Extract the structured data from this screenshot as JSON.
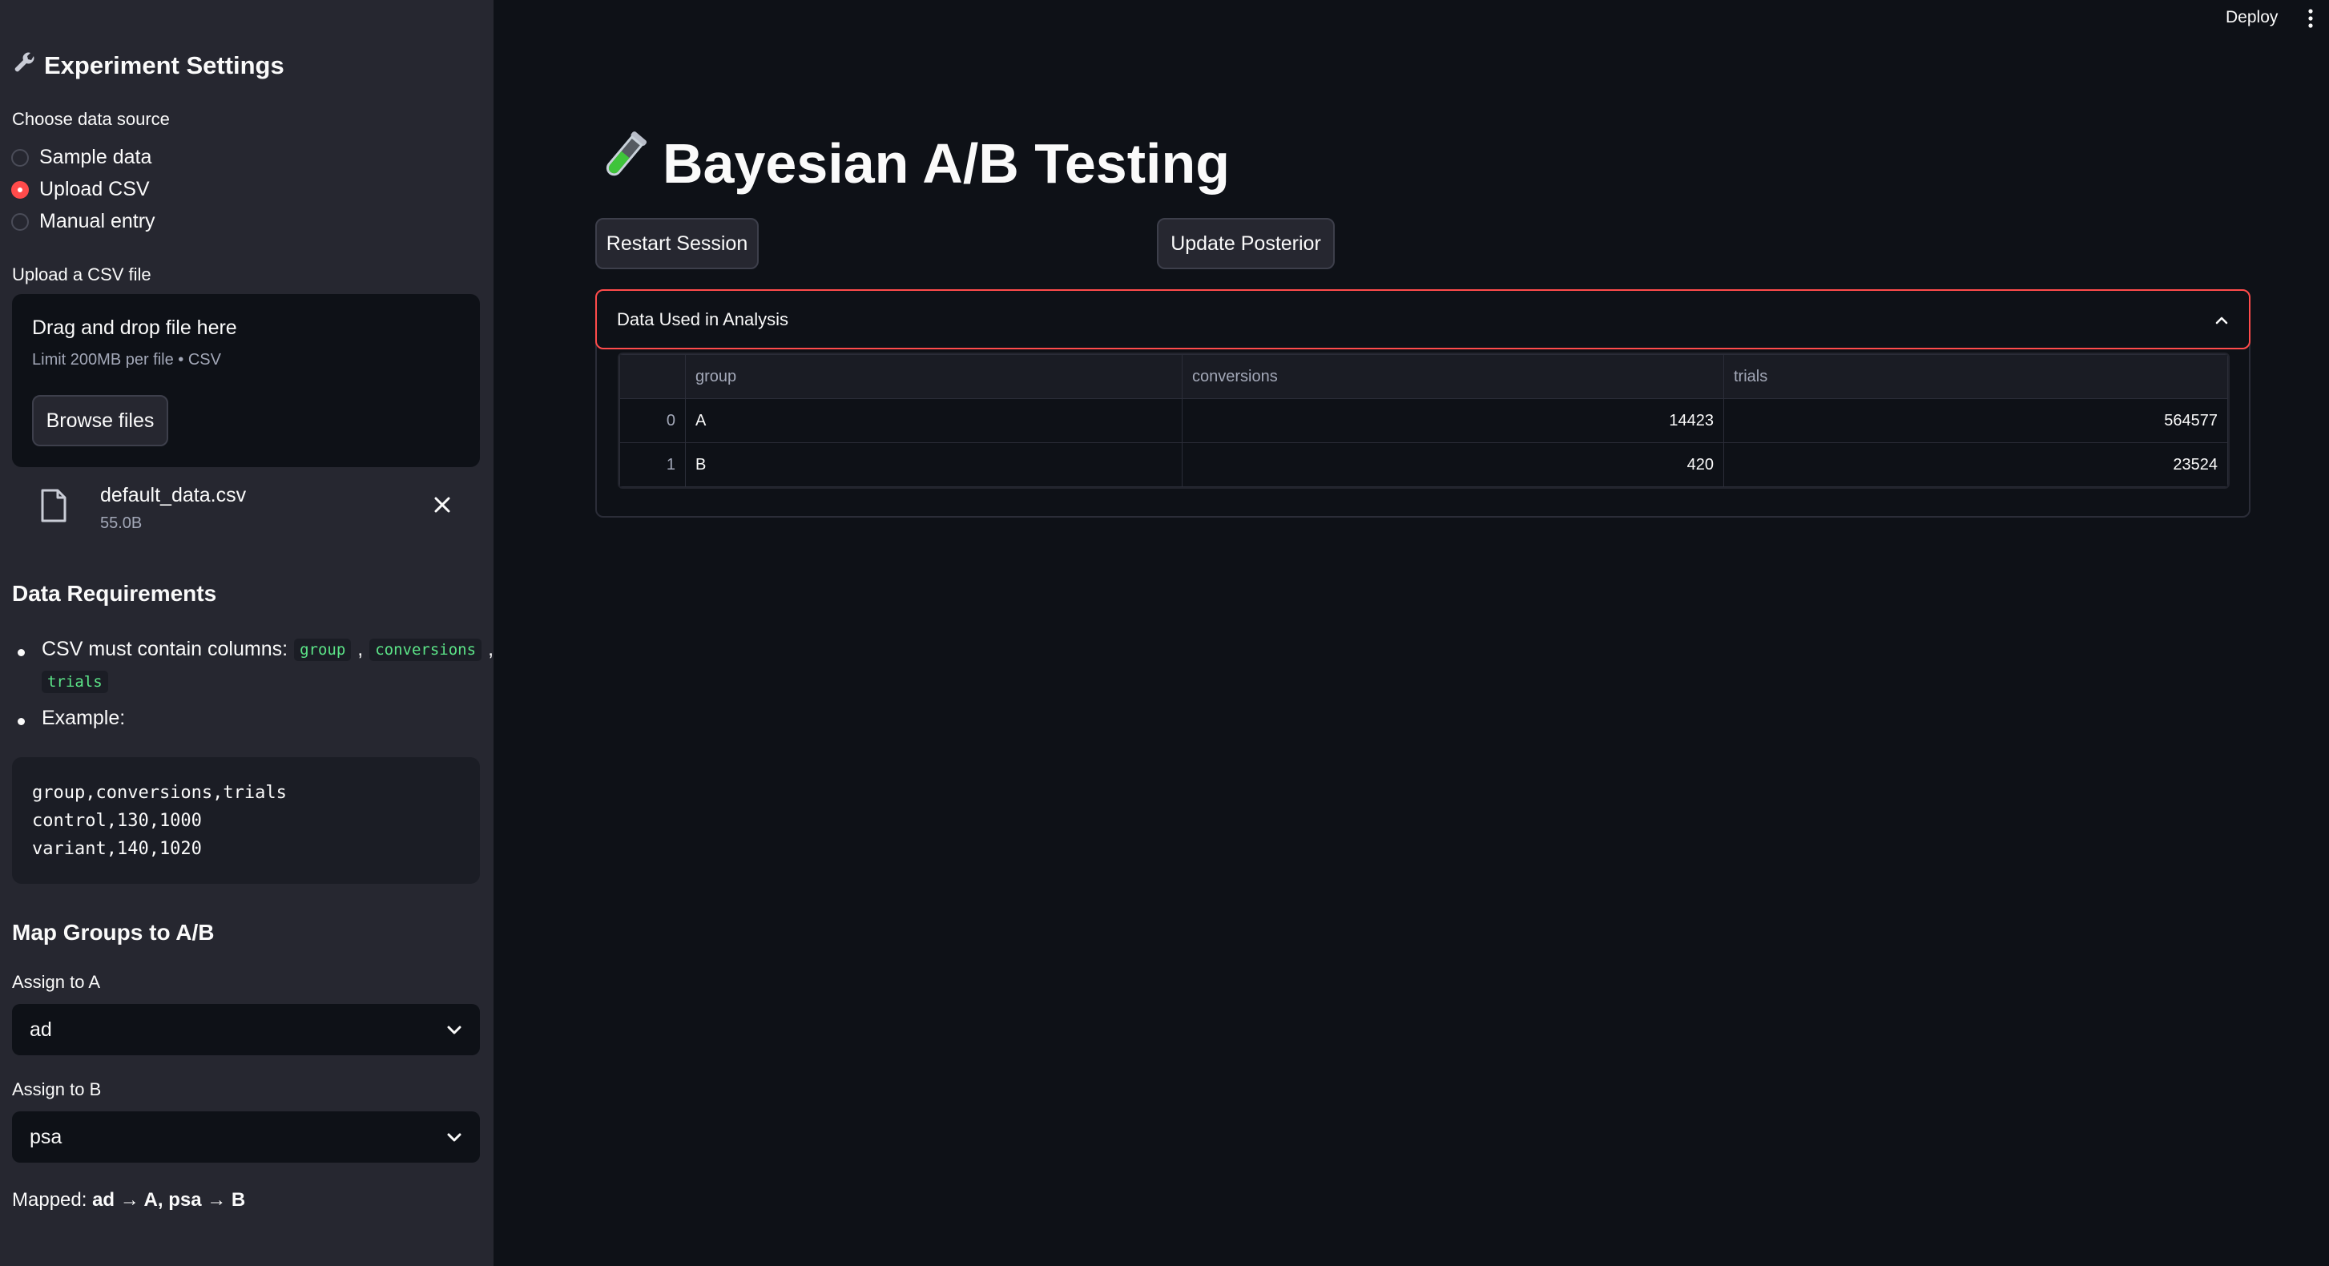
{
  "header": {
    "deploy_label": "Deploy"
  },
  "sidebar": {
    "title": "Experiment Settings",
    "data_source_label": "Choose data source",
    "data_source_options": [
      "Sample data",
      "Upload CSV",
      "Manual entry"
    ],
    "data_source_selected": "Upload CSV",
    "upload_label": "Upload a CSV file",
    "dropzone_title": "Drag and drop file here",
    "dropzone_limit": "Limit 200MB per file • CSV",
    "browse_label": "Browse files",
    "file_name": "default_data.csv",
    "file_size": "55.0B",
    "requirements_title": "Data Requirements",
    "requirements_text": "CSV must contain columns:",
    "required_columns": [
      "group",
      "conversions",
      "trials"
    ],
    "example_label": "Example:",
    "example_code": [
      "group,conversions,trials",
      "control,130,1000",
      "variant,140,1020"
    ],
    "map_title": "Map Groups to A/B",
    "assign_a_label": "Assign to A",
    "assign_a_value": "ad",
    "assign_b_label": "Assign to B",
    "assign_b_value": "psa",
    "mapped_prefix": "Mapped:",
    "mapped_value": "ad → A, psa → B",
    "accent_color": "#ff4b4b"
  },
  "main": {
    "title": "Bayesian A/B Testing",
    "title_icon": "test-tube-icon",
    "restart_label": "Restart Session",
    "update_label": "Update Posterior",
    "expander_label": "Data Used in Analysis",
    "table": {
      "columns": [
        "group",
        "conversions",
        "trials"
      ],
      "rows": [
        {
          "index": "0",
          "group": "A",
          "conversions": "14423",
          "trials": "564577"
        },
        {
          "index": "1",
          "group": "B",
          "conversions": "420",
          "trials": "23524"
        }
      ]
    }
  }
}
